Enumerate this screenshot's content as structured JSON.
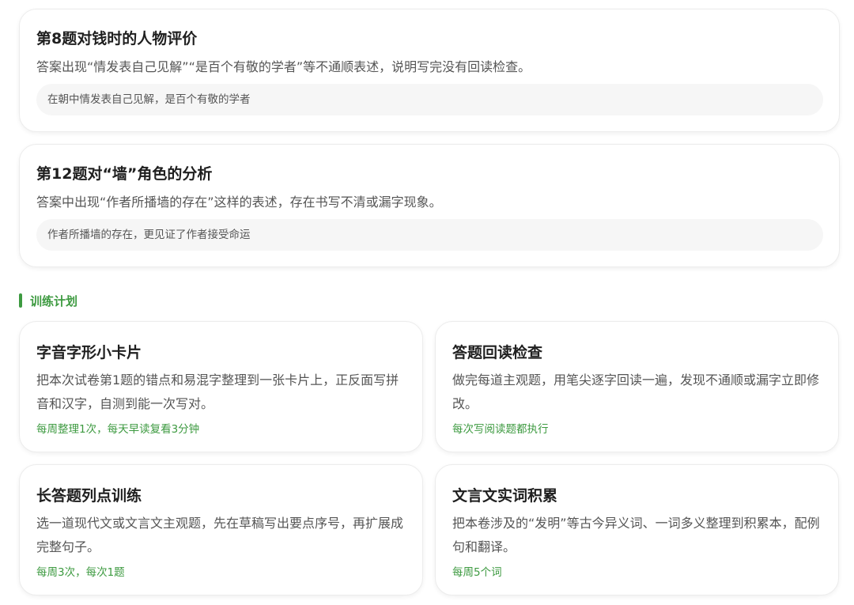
{
  "issues": [
    {
      "title": "第8题对钱时的人物评价",
      "description": "答案出现“情发表自己见解”“是百个有敬的学者”等不通顺表述，说明写完没有回读检查。",
      "quote": "在朝中情发表自己见解，是百个有敬的学者"
    },
    {
      "title": "第12题对“墙”角色的分析",
      "description": "答案中出现“作者所播墙的存在”这样的表述，存在书写不清或漏字现象。",
      "quote": "作者所播墙的存在，更见证了作者接受命运"
    }
  ],
  "plan": {
    "section_title": "训练计划",
    "accent_color": "#3d9a40",
    "items": [
      {
        "title": "字音字形小卡片",
        "description": "把本次试卷第1题的错点和易混字整理到一张卡片上，正反面写拼音和汉字，自测到能一次写对。",
        "frequency": "每周整理1次，每天早读复看3分钟"
      },
      {
        "title": "答题回读检查",
        "description": "做完每道主观题，用笔尖逐字回读一遍，发现不通顺或漏字立即修改。",
        "frequency": "每次写阅读题都执行"
      },
      {
        "title": "长答题列点训练",
        "description": "选一道现代文或文言文主观题，先在草稿写出要点序号，再扩展成完整句子。",
        "frequency": "每周3次，每次1题"
      },
      {
        "title": "文言文实词积累",
        "description": "把本卷涉及的“发明”等古今异义词、一词多义整理到积累本，配例句和翻译。",
        "frequency": "每周5个词"
      }
    ]
  }
}
